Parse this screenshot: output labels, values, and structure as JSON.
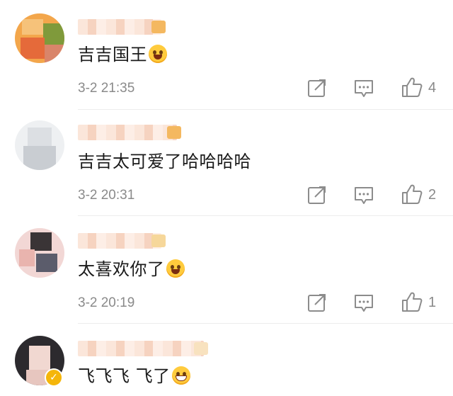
{
  "comments": [
    {
      "text": "吉吉国王",
      "emoji": "crying-laughing-emoji",
      "time": "3-2 21:35",
      "likes": "4"
    },
    {
      "text": "吉吉太可爱了哈哈哈哈",
      "emoji": "",
      "time": "3-2 20:31",
      "likes": "2"
    },
    {
      "text": "太喜欢你了",
      "emoji": "crying-laughing-emoji",
      "time": "3-2 20:19",
      "likes": "1"
    },
    {
      "text": "飞飞飞 飞了",
      "emoji": "grinning-emoji",
      "time": "",
      "likes": ""
    }
  ],
  "icons": {
    "share": "share-icon",
    "reply": "reply-comment-icon",
    "like": "thumbs-up-icon",
    "verified": "verified-badge-icon"
  },
  "colors": {
    "meta_gray": "#8a8a8a",
    "icon_gray": "#8c8c8c",
    "verified_gold": "#f5b60b"
  }
}
